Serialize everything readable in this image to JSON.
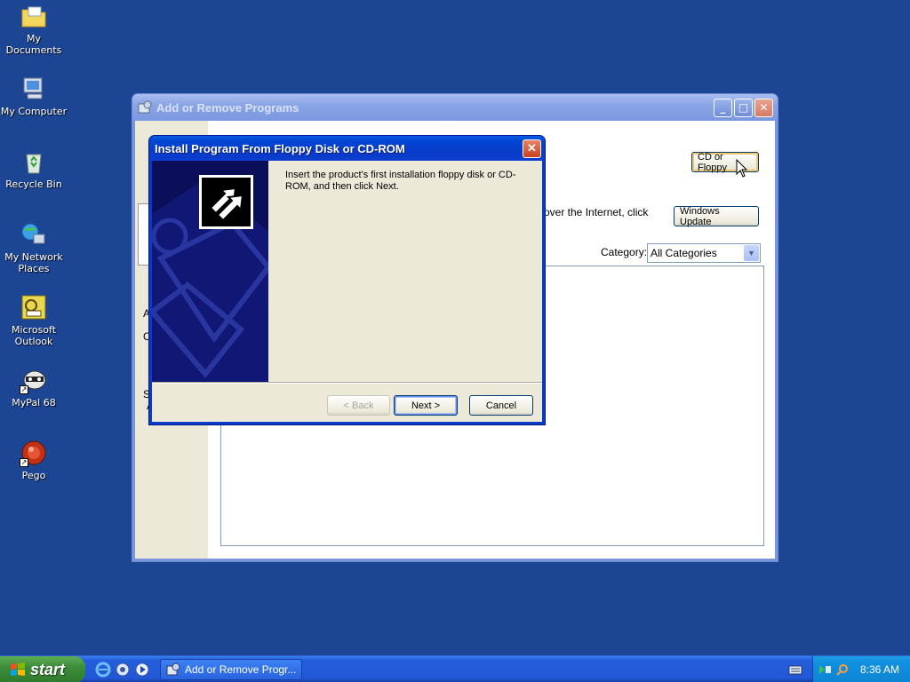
{
  "desktop": {
    "icons": [
      {
        "label": "My Documents"
      },
      {
        "label": "My Computer"
      },
      {
        "label": "Recycle Bin"
      },
      {
        "label": "My Network Places"
      },
      {
        "label": "Microsoft Outlook"
      },
      {
        "label": "MyPal 68"
      },
      {
        "label": "Pego"
      }
    ]
  },
  "main_window": {
    "title": "Add or Remove Programs",
    "cd_button_label": "CD or Floppy",
    "internet_text_fragment": "over the Internet, click",
    "windows_update_label": "Windows Update",
    "category_label": "Category:",
    "category_value": "All Categories",
    "left_fragments": [
      "A",
      "C",
      "S",
      "A"
    ]
  },
  "dialog": {
    "title": "Install Program From Floppy Disk or CD-ROM",
    "instruction": "Insert the product's first installation floppy disk or CD-ROM, and then click Next.",
    "back_label": "< Back",
    "next_label": "Next >",
    "cancel_label": "Cancel"
  },
  "taskbar": {
    "start_label": "start",
    "task_label": "Add or Remove Progr...",
    "clock": "8:36 AM"
  },
  "colors": {
    "desktop": "#1c4593",
    "dialog_title": "#0a3ac8",
    "dialog_face": "#ece9d8",
    "taskbar": "#245edb",
    "start": "#3c8d3b"
  }
}
